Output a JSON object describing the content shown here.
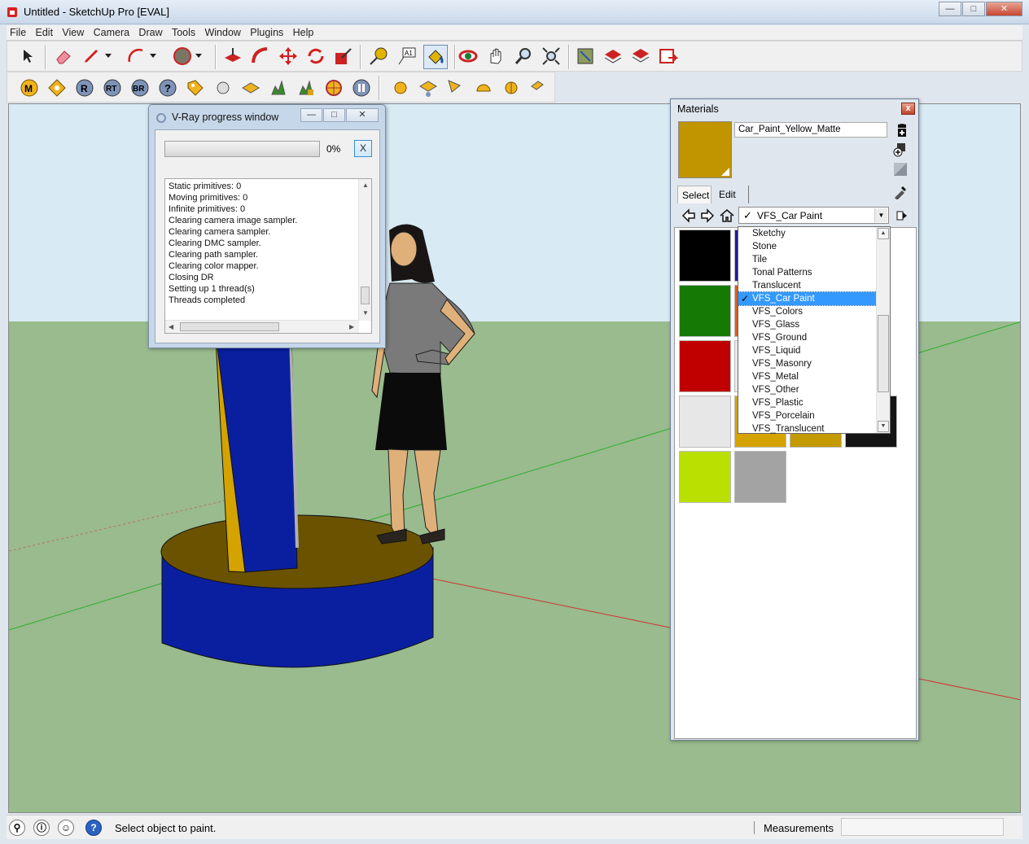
{
  "window": {
    "title": "Untitled - SketchUp Pro [EVAL]",
    "min": "—",
    "max": "□",
    "close": "✕"
  },
  "menu": [
    "File",
    "Edit",
    "View",
    "Camera",
    "Draw",
    "Tools",
    "Window",
    "Plugins",
    "Help"
  ],
  "toolbar_icons": [
    "select-icon",
    "eraser-icon",
    "pencil-icon",
    "arc-icon",
    "circle-icon",
    "pushpull-icon",
    "followme-icon",
    "move-icon",
    "rotate-icon",
    "scale-icon",
    "tape-measure-icon",
    "text-icon",
    "paint-bucket-icon",
    "orbit-icon",
    "pan-icon",
    "zoom-icon",
    "zoom-extents-icon",
    "map-icon",
    "3dwarehouse-icon",
    "components-icon",
    "send-to-layout-icon"
  ],
  "vray_toolbar": [
    "M",
    "R",
    "RT",
    "BR",
    "?"
  ],
  "vray": {
    "title": "V-Ray progress window",
    "percent": "0%",
    "progress": 0,
    "abort_label": "X",
    "log": [
      "Static primitives: 0",
      "Moving primitives: 0",
      "Infinite primitives: 0",
      "Clearing camera image sampler.",
      "Clearing camera sampler.",
      "Clearing DMC sampler.",
      "Clearing path sampler.",
      "Clearing color mapper.",
      "Closing DR",
      "Setting up 1 thread(s)",
      "Threads completed"
    ]
  },
  "materials": {
    "title": "Materials",
    "close": "x",
    "material_name": "Car_Paint_Yellow_Matte",
    "current_color": "#c09500",
    "tabs": [
      "Select",
      "Edit"
    ],
    "library": "VFS_Car Paint",
    "library_check": "✓",
    "dropdown": [
      "Sketchy",
      "Stone",
      "Tile",
      "Tonal Patterns",
      "Translucent",
      "VFS_Car Paint",
      "VFS_Colors",
      "VFS_Glass",
      "VFS_Ground",
      "VFS_Liquid",
      "VFS_Masonry",
      "VFS_Metal",
      "VFS_Other",
      "VFS_Plastic",
      "VFS_Porcelain",
      "VFS_Translucent"
    ],
    "selected_index": 5,
    "swatches": [
      "#000000",
      "#1f1a9e",
      "#157a05",
      "#e05a10",
      "#c00000",
      "#e9e9e9",
      "#e7e7e7",
      "#d4a300",
      "#c39a00",
      "#141414",
      "#b9e000",
      "#a3a3a3"
    ]
  },
  "status": {
    "message": "Select object to paint.",
    "measurements_label": "Measurements",
    "measurements_value": ""
  }
}
